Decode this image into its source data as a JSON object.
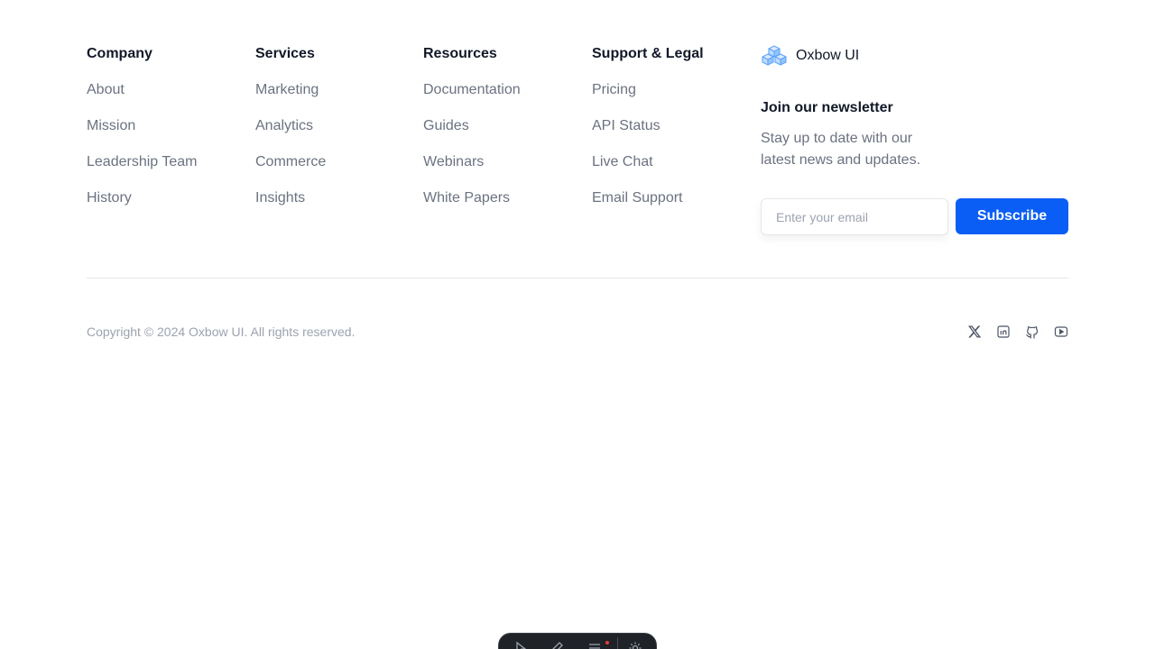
{
  "columns": [
    {
      "title": "Company",
      "links": [
        "About",
        "Mission",
        "Leadership Team",
        "History"
      ]
    },
    {
      "title": "Services",
      "links": [
        "Marketing",
        "Analytics",
        "Commerce",
        "Insights"
      ]
    },
    {
      "title": "Resources",
      "links": [
        "Documentation",
        "Guides",
        "Webinars",
        "White Papers"
      ]
    },
    {
      "title": "Support & Legal",
      "links": [
        "Pricing",
        "API Status",
        "Live Chat",
        "Email Support"
      ]
    }
  ],
  "brand": {
    "name": "Oxbow UI",
    "logo_icon": "cubes-logo-icon",
    "logo_color": "#60a5fa"
  },
  "newsletter": {
    "title": "Join our newsletter",
    "description": "Stay up to date with our latest news and updates.",
    "email_placeholder": "Enter your email",
    "email_value": "",
    "subscribe_label": "Subscribe",
    "button_color": "#0a5ef5"
  },
  "bottom": {
    "copyright": "Copyright © 2024 Oxbow UI. All rights reserved.",
    "socials": [
      "x-icon",
      "linkedin-icon",
      "github-icon",
      "youtube-icon"
    ]
  },
  "dock": {
    "icons": [
      "pointer-icon",
      "pen-icon",
      "menu-icon",
      "settings-icon"
    ]
  }
}
